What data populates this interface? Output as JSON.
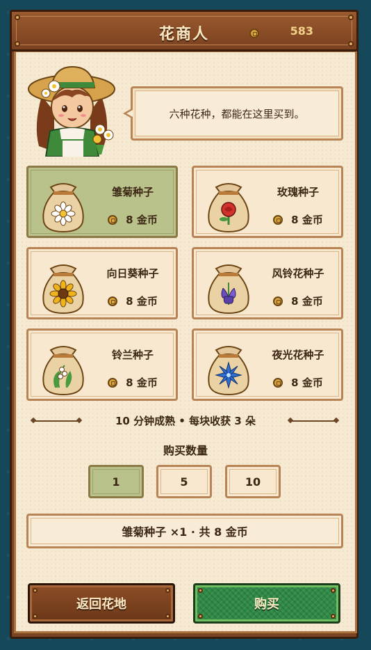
{
  "header": {
    "title": "花商人",
    "coins": "583"
  },
  "merchant": {
    "dialog": "六种花种，都能在这里买到。"
  },
  "seeds": [
    {
      "name": "雏菊种子",
      "price": "8 金币",
      "flower_icon": "daisy-icon",
      "selected": true
    },
    {
      "name": "玫瑰种子",
      "price": "8 金币",
      "flower_icon": "rose-icon",
      "selected": false
    },
    {
      "name": "向日葵种子",
      "price": "8 金币",
      "flower_icon": "sunflower-icon",
      "selected": false
    },
    {
      "name": "风铃花种子",
      "price": "8 金币",
      "flower_icon": "bellflower-icon",
      "selected": false
    },
    {
      "name": "铃兰种子",
      "price": "8 金币",
      "flower_icon": "lily-of-the-valley-icon",
      "selected": false
    },
    {
      "name": "夜光花种子",
      "price": "8 金币",
      "flower_icon": "nightglow-flower-icon",
      "selected": false
    }
  ],
  "info": "10 分钟成熟 • 每块收获 3 朵",
  "quantity": {
    "label": "购买数量",
    "options": [
      "1",
      "5",
      "10"
    ],
    "selected": "1"
  },
  "summary": "雏菊种子 ×1 · 共 8 金币",
  "buttons": {
    "back": "返回花地",
    "buy": "购买"
  },
  "colors": {
    "frame": "#7a4423",
    "parchment": "#f6ead3",
    "selected": "#b9c28a",
    "buy_button": "#2f8a45",
    "text": "#3c2614"
  }
}
